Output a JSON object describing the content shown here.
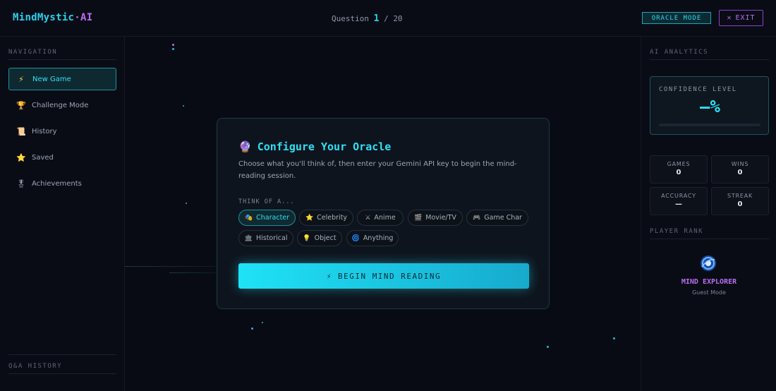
{
  "header": {
    "logo_main": "MindMystic",
    "logo_sep": "·",
    "logo_ai": "AI",
    "question_prefix": "Question",
    "question_current": "1",
    "question_sep": "/",
    "question_total": "20",
    "oracle_mode_label": "ORACLE MODE",
    "exit_label": "EXIT",
    "exit_icon": "✕"
  },
  "sidebar": {
    "nav_title": "NAVIGATION",
    "items": [
      {
        "label": "New Game",
        "icon": "⚡",
        "icon_name": "lightning-icon",
        "active": true
      },
      {
        "label": "Challenge Mode",
        "icon": "🏆",
        "icon_name": "trophy-icon"
      },
      {
        "label": "History",
        "icon": "📜",
        "icon_name": "scroll-icon"
      },
      {
        "label": "Saved",
        "icon": "⭐",
        "icon_name": "star-icon"
      },
      {
        "label": "Achievements",
        "icon": "🎖",
        "icon_name": "medal-icon"
      }
    ],
    "qa_history_title": "Q&A HISTORY"
  },
  "analytics": {
    "title": "AI ANALYTICS",
    "confidence_label": "CONFIDENCE LEVEL",
    "confidence_value": "—%",
    "confidence_fraction": 0,
    "stats": [
      {
        "label": "GAMES",
        "value": "0"
      },
      {
        "label": "WINS",
        "value": "0"
      },
      {
        "label": "ACCURACY",
        "value": "—"
      },
      {
        "label": "STREAK",
        "value": "0"
      }
    ],
    "rank_title": "PLAYER RANK",
    "rank_name": "MIND EXPLORER",
    "rank_mode": "Guest Mode"
  },
  "config": {
    "title": "Configure Your Oracle",
    "title_icon": "🔮",
    "description": "Choose what you'll think of, then enter your Gemini API key to begin the mind-reading session.",
    "think_label": "THINK OF A...",
    "chips": [
      {
        "label": "Character",
        "icon": "🎭",
        "selected": true
      },
      {
        "label": "Celebrity",
        "icon": "⭐"
      },
      {
        "label": "Anime",
        "icon": "⚔"
      },
      {
        "label": "Movie/TV",
        "icon": "🎬"
      },
      {
        "label": "Game Char",
        "icon": "🎮"
      },
      {
        "label": "Historical",
        "icon": "🏛"
      },
      {
        "label": "Object",
        "icon": "💡"
      },
      {
        "label": "Anything",
        "icon": "🌀"
      }
    ],
    "begin_label": "BEGIN MIND READING",
    "begin_icon": "⚡"
  },
  "colors": {
    "accent_cyan": "#27d3f0",
    "accent_purple": "#b86cf0",
    "background": "#090b14"
  }
}
